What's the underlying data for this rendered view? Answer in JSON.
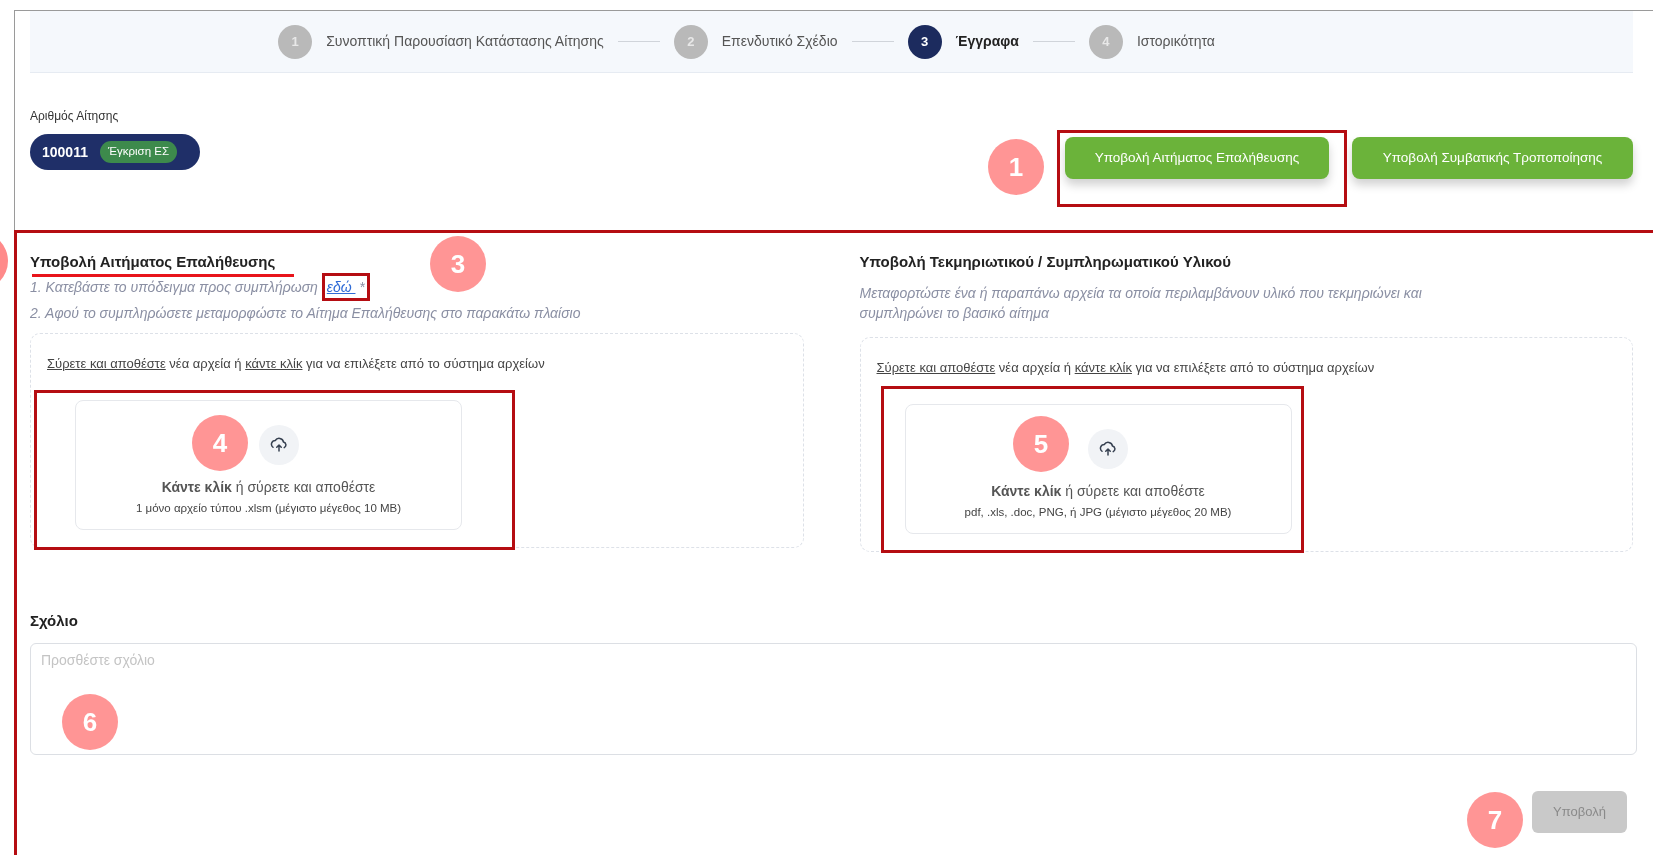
{
  "stepper": [
    {
      "number": "1",
      "label": "Συνοπτική Παρουσίαση Κατάστασης Αίτησης",
      "selected": false
    },
    {
      "number": "2",
      "label": "Επενδυτικό Σχέδιο",
      "selected": false
    },
    {
      "number": "3",
      "label": "Έγγραφα",
      "selected": true
    },
    {
      "number": "4",
      "label": "Ιστορικότητα",
      "selected": false
    }
  ],
  "application": {
    "label": "Αριθμός Αίτησης",
    "number": "100011",
    "status": "Έγκριση ΕΣ"
  },
  "actions": [
    "Υποβολή Αιτήματος Επαλήθευσης",
    "Υποβολή Συμβατικής Τροποποίησης"
  ],
  "sections": [
    {
      "title": "Υποβολή Αιτήματος Επαλήθευσης",
      "instructions": [
        {
          "text": "1. Κατεβάστε το υπόδειγμα προς συμπλήρωση ",
          "link": "εδώ ",
          "after": " *"
        },
        {
          "text": "2. Αφού το συμπληρώσετε μεταμορφώστε το Αίτημα Επαλήθευσης στο παρακάτω πλαίσιο"
        }
      ],
      "drop_hint": [
        {
          "text": "Σύρετε και αποθέστε",
          "link": true
        },
        {
          "text": " νέα αρχεία ή ",
          "link": false
        },
        {
          "text": "κάντε κλίκ",
          "link": true
        },
        {
          "text": " για να επιλέξετε από το σύστημα αρχείων",
          "link": false
        }
      ],
      "upload": {
        "title": "**Κάντε κλίκ** ή σύρετε και αποθέστε",
        "note": "1 μόνο αρχείο τύπου .xlsm (μέγιστο μέγεθος 10 MB)"
      }
    },
    {
      "title": "Υποβολή Τεκμηριωτικού / Συμπληρωματικού Υλικού",
      "instructions": [
        {
          "text": "Μεταφορτώστε ένα ή παραπάνω αρχεία τα οποία περιλαμβάνουν υλικό που τεκμηριώνει και συμπληρώνει το βασικό αίτημα"
        }
      ],
      "drop_hint": [
        {
          "text": "Σύρετε και αποθέστε",
          "link": true
        },
        {
          "text": " νέα αρχεία ή ",
          "link": false
        },
        {
          "text": "κάντε κλίκ",
          "link": true
        },
        {
          "text": " για να επιλέξετε από το σύστημα αρχείων",
          "link": false
        }
      ],
      "upload": {
        "title": "**Κάντε κλίκ** ή σύρετε και αποθέστε",
        "note": "pdf, .xls, .doc, PNG, ή JPG (μέγιστο μέγεθος 20 MB)"
      }
    }
  ],
  "comment": {
    "label": "Σχόλιο",
    "placeholder": "Προσθέστε σχόλιο"
  },
  "submit": {
    "label": "Υποβολή",
    "disabled": true
  },
  "annotations": [
    {
      "label": "1"
    },
    {
      "label": "3"
    },
    {
      "label": "4"
    },
    {
      "label": "5"
    },
    {
      "label": "6"
    },
    {
      "label": "7"
    }
  ]
}
